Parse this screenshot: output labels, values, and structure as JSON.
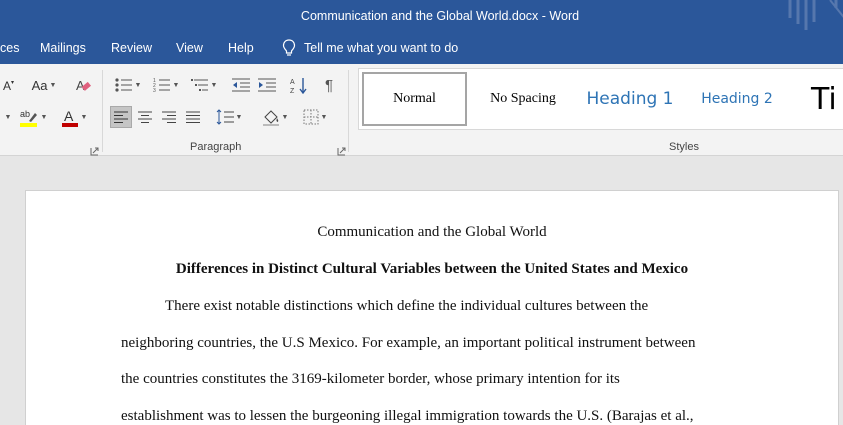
{
  "window": {
    "title": "Communication and the Global World.docx  -  Word"
  },
  "tabs": [
    "ces",
    "Mailings",
    "Review",
    "View",
    "Help"
  ],
  "tell_me": {
    "placeholder": "Tell me what you want to do"
  },
  "ribbon": {
    "paragraph_label": "Paragraph",
    "styles_label": "Styles",
    "font_aa_label": "Aa"
  },
  "styles_gallery": [
    {
      "label": "Normal",
      "selected": true
    },
    {
      "label": "No Spacing"
    },
    {
      "label": "Heading 1"
    },
    {
      "label": "Heading 2"
    },
    {
      "label": "Ti"
    }
  ],
  "colors": {
    "titlebar": "#2b579a",
    "heading_blue": "#2e74b5",
    "highlight": "#ffff00",
    "font_color": "#c00000"
  },
  "document": {
    "title": "Communication and the Global World",
    "heading": "Differences in Distinct Cultural Variables between the United States and Mexico",
    "lines": [
      "There exist notable distinctions which define the individual cultures between the",
      "neighboring countries, the U.S Mexico. For example, an important political instrument between",
      "the countries constitutes the 3169-kilometer border, whose primary intention for its",
      "establishment was to lessen the burgeoning illegal immigration towards the U.S. (Barajas et al.,"
    ]
  }
}
